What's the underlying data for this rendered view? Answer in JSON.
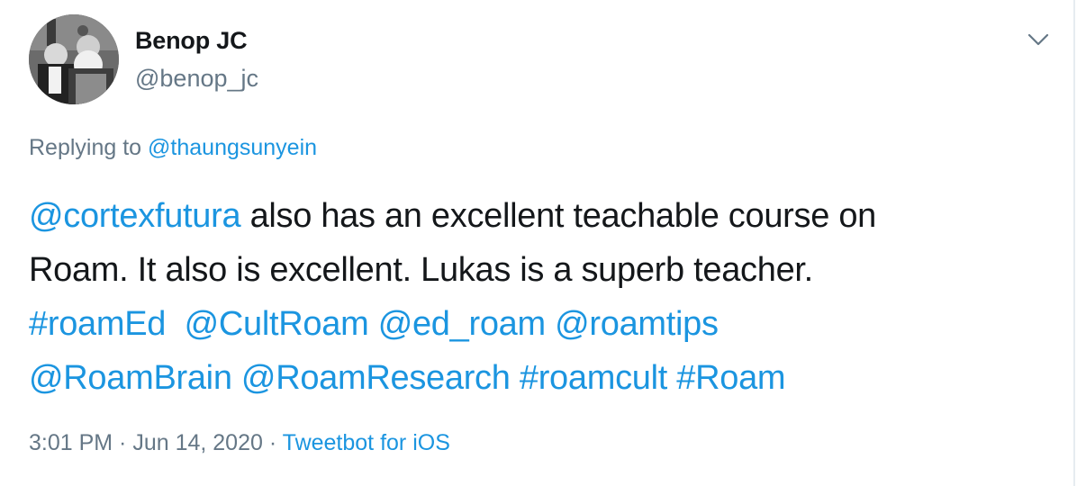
{
  "author": {
    "name": "Benop JC",
    "handle": "@benop_jc"
  },
  "reply": {
    "prefix": "Replying to ",
    "to": "@thaungsunyein"
  },
  "tweet": {
    "line1": {
      "mention": "@cortexfutura",
      "text": " also has an excellent teachable course on"
    },
    "line2": {
      "text": "Roam. It also is excellent. Lukas is a superb teacher."
    },
    "line3": {
      "tag1": "#roamEd",
      "gap": "  ",
      "m1": "@CultRoam",
      "m2": "@ed_roam",
      "m3": "@roamtips"
    },
    "line4": {
      "m1": "@RoamBrain",
      "m2": "@RoamResearch",
      "tag1": "#roamcult",
      "tag2": "#Roam"
    }
  },
  "meta": {
    "time": "3:01 PM",
    "separator": " · ",
    "date": "Jun 14, 2020",
    "source": "Tweetbot for iOS"
  },
  "icons": {
    "chevron": "chevron-down-icon"
  },
  "colors": {
    "link": "#1b95e0",
    "secondary": "#657786",
    "text": "#14171a"
  }
}
